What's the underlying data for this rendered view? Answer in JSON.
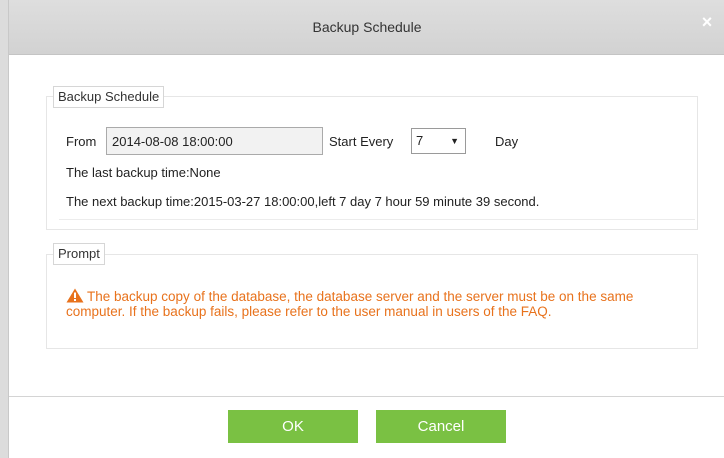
{
  "dialog": {
    "title": "Backup Schedule",
    "close_label": "×"
  },
  "schedule": {
    "group_label": "Backup Schedule",
    "from_label": "From",
    "from_value": "2014-08-08 18:00:00",
    "start_every_label": "Start Every",
    "interval_value": "7",
    "interval_unit": "Day",
    "last_backup": "The last backup time:None",
    "next_backup": "The next backup time:2015-03-27 18:00:00,left 7 day 7 hour 59 minute 39 second."
  },
  "prompt": {
    "group_label": "Prompt",
    "message": "The backup copy of the database, the database server and the server must be on the same computer. If the backup fails, please refer to the user manual in users of the FAQ.",
    "warning_color": "#e8721c"
  },
  "footer": {
    "ok_label": "OK",
    "cancel_label": "Cancel",
    "button_color": "#7ac143"
  },
  "icons": {
    "warning": "warning-icon",
    "dropdown": "chevron-down-icon"
  }
}
